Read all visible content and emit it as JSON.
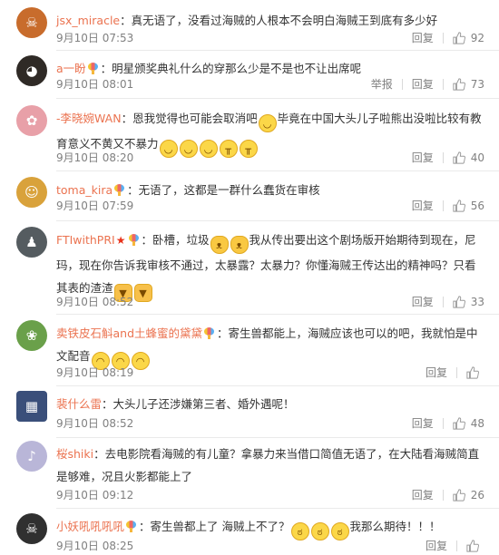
{
  "actions": {
    "reply": "回复",
    "report": "举报"
  },
  "comments": [
    {
      "user": "jsx_miracle",
      "badge": false,
      "star": false,
      "text": "：真无语了，没看过海贼的人根本不会明白海贼王到底有多少好",
      "time": "9月10日 07:53",
      "likes": "92",
      "report": false,
      "avatar_color": "#c86c2c",
      "avatar_glyph": "☠"
    },
    {
      "user": "a一盼",
      "badge": true,
      "star": false,
      "text": "：明星颁奖典礼什么的穿那么少是不是也不让出席呢",
      "time": "9月10日 08:01",
      "likes": "73",
      "report": true,
      "avatar_color": "#2f2a26",
      "avatar_glyph": "◕"
    },
    {
      "user": "-李晓婉WAN",
      "badge": false,
      "star": false,
      "text_a": "：恩我觉得也可能会取消吧",
      "text_b": "毕竟在中国大头儿子啦熊出没啦比较有教育意义不黄又不暴力",
      "time": "9月10日 08:20",
      "likes": "40",
      "report": false,
      "avatar_color": "#e8a0a8",
      "avatar_glyph": "✿"
    },
    {
      "user": "toma_kira",
      "badge": true,
      "star": false,
      "text": "：无语了，这都是一群什么蠢货在审核",
      "time": "9月10日 07:59",
      "likes": "56",
      "report": false,
      "avatar_color": "#d9a23b",
      "avatar_glyph": "☺"
    },
    {
      "user": "FTIwithPRI",
      "badge": true,
      "star": true,
      "text_a": "：卧槽，垃圾",
      "text_b": "我从传出要出这个剧场版开始期待到现在，尼玛，现在你告诉我审核不通过，太暴露？太暴力？你懂海贼王传达出的精神吗？只看其表的渣渣",
      "time": "9月10日 08:52",
      "likes": "33",
      "report": false,
      "avatar_color": "#555c60",
      "avatar_glyph": "♟"
    },
    {
      "user": "卖铁皮石斛and土蜂蜜的黛黛",
      "badge": true,
      "star": false,
      "text_a": "：寄生兽都能上，海贼应该也可以的吧，我就怕是中文配音",
      "text_b": "",
      "time": "9月10日 08:19",
      "likes": "",
      "report": false,
      "avatar_color": "#6aa04a",
      "avatar_glyph": "❀"
    },
    {
      "user": "裴什么雷",
      "badge": false,
      "star": false,
      "text": "：大头儿子还涉嫌第三者、婚外遇呢！",
      "time": "9月10日 08:52",
      "likes": "48",
      "report": false,
      "avatar_color": "#3a4f7a",
      "avatar_glyph": "▦"
    },
    {
      "user": "桜shiki",
      "badge": false,
      "star": false,
      "text": "：去电影院看海贼的有儿童？拿暴力来当借口简值无语了，在大陆看海贼简直是够难，况且火影都能上了",
      "time": "9月10日 09:12",
      "likes": "26",
      "report": false,
      "avatar_color": "#b9b6d8",
      "avatar_glyph": "♪"
    },
    {
      "user": "小妖吼吼吼吼",
      "badge": true,
      "star": false,
      "text_a": "：寄生兽都上了 海贼上不了？",
      "text_b": "我那么期待！！！",
      "time": "9月10日 08:25",
      "likes": "",
      "report": false,
      "avatar_color": "#303030",
      "avatar_glyph": "☠"
    }
  ]
}
